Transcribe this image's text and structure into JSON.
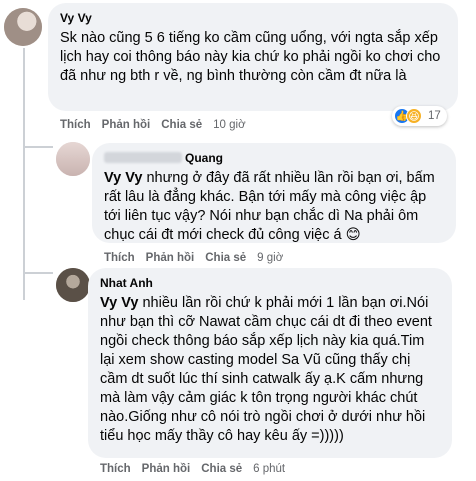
{
  "comments": [
    {
      "author": "Vy Vy",
      "text": "Sk nào cũng 5 6 tiếng ko cầm cũng uổng, với ngta sắp xếp lịch hay coi thông báo này kia chứ ko phải ngồi ko chơi cho đã như ng bth r về, ng bình thường còn cầm đt nữa là",
      "actions": {
        "like": "Thích",
        "reply": "Phản hồi",
        "share": "Chia sẻ",
        "time": "10 giờ"
      },
      "reactions": {
        "icons": [
          "like-icon",
          "haha-icon"
        ],
        "count": "17"
      }
    },
    {
      "author": "Quang",
      "mention": "Vy Vy",
      "text": " nhưng ở đây đã rất nhiều lần rồi bạn ơi, bấm rất lâu là đẳng khác. Bận tới mấy mà công việc ập tới liên tục vậy? Nói như bạn chắc dì Na phải ôm chục cái đt mới check đủ công việc á 😊",
      "actions": {
        "like": "Thích",
        "reply": "Phản hồi",
        "share": "Chia sẻ",
        "time": "9 giờ"
      }
    },
    {
      "author": "Nhat Anh",
      "mention": "Vy Vy",
      "text": " nhiều lần rồi chứ k phải mới 1 lần bạn ơi.Nói như bạn thì cỡ Nawat cầm chục cái dt đi theo event ngồi check thông báo sắp xếp lịch này kia quá.Tim lại xem show casting model Sa Vũ cũng thấy chị cầm dt suốt lúc thí sinh catwalk ấy ạ.K cấm nhưng mà làm vậy cảm giác k tôn trọng người khác chút nào.Giống như cô nói trò ngồi chơi ở dưới như hồi tiểu học mấy thầy cô hay kêu ấy =)))))",
      "actions": {
        "like": "Thích",
        "reply": "Phản hồi",
        "share": "Chia sẻ",
        "time": "6 phút"
      }
    }
  ]
}
